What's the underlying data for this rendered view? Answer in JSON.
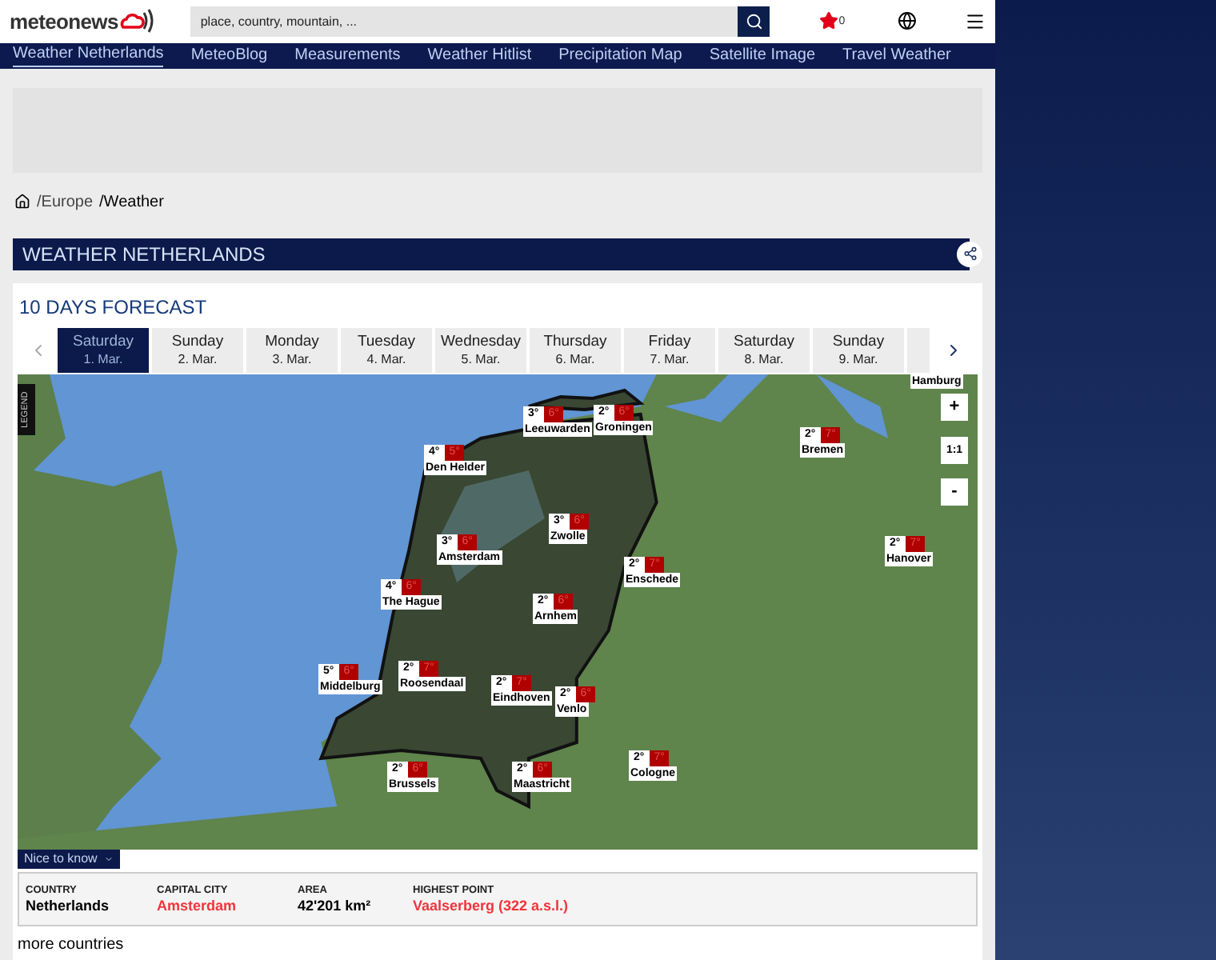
{
  "header": {
    "logo": "meteonews",
    "search": {
      "placeholder": "place, country, mountain, ..."
    },
    "favorites_count": "0"
  },
  "nav": [
    {
      "label": "Weather Netherlands",
      "selected": true
    },
    {
      "label": "MeteoBlog",
      "selected": false
    },
    {
      "label": "Measurements",
      "selected": false
    },
    {
      "label": "Weather Hitlist",
      "selected": false
    },
    {
      "label": "Precipitation Map",
      "selected": false
    },
    {
      "label": "Satellite Image",
      "selected": false
    },
    {
      "label": "Travel Weather",
      "selected": false
    }
  ],
  "breadcrumb": [
    "/Europe",
    "/Weather"
  ],
  "page_title": "WEATHER NETHERLANDS",
  "forecast": {
    "title": "10 DAYS FORECAST",
    "days": [
      {
        "day": "Saturday",
        "date": "1. Mar.",
        "selected": true
      },
      {
        "day": "Sunday",
        "date": "2. Mar.",
        "selected": false
      },
      {
        "day": "Monday",
        "date": "3. Mar.",
        "selected": false
      },
      {
        "day": "Tuesday",
        "date": "4. Mar.",
        "selected": false
      },
      {
        "day": "Wednesday",
        "date": "5. Mar.",
        "selected": false
      },
      {
        "day": "Thursday",
        "date": "6. Mar.",
        "selected": false
      },
      {
        "day": "Friday",
        "date": "7. Mar.",
        "selected": false
      },
      {
        "day": "Saturday",
        "date": "8. Mar.",
        "selected": false
      },
      {
        "day": "Sunday",
        "date": "9. Mar.",
        "selected": false
      }
    ],
    "map": {
      "legend": "LEGEND",
      "zoom_in": "+",
      "reset": "1:1",
      "zoom_out": "-",
      "markers": [
        {
          "city": "Hamburg"
        },
        {
          "city": "Leeuwarden",
          "min": "3°",
          "max": "6°"
        },
        {
          "city": "Groningen",
          "min": "2°",
          "max": "6°"
        },
        {
          "city": "Den Helder",
          "min": "4°",
          "max": "5°"
        },
        {
          "city": "Bremen",
          "min": "2°",
          "max": "7°"
        },
        {
          "city": "Zwolle",
          "min": "3°",
          "max": "6°"
        },
        {
          "city": "Amsterdam",
          "min": "3°",
          "max": "6°"
        },
        {
          "city": "Hanover",
          "min": "2°",
          "max": "7°"
        },
        {
          "city": "Enschede",
          "min": "2°",
          "max": "7°"
        },
        {
          "city": "The Hague",
          "min": "4°",
          "max": "6°"
        },
        {
          "city": "Arnhem",
          "min": "2°",
          "max": "6°"
        },
        {
          "city": "Middelburg",
          "min": "5°",
          "max": "6°"
        },
        {
          "city": "Roosendaal",
          "min": "2°",
          "max": "7°"
        },
        {
          "city": "Eindhoven",
          "min": "2°",
          "max": "7°"
        },
        {
          "city": "Venlo",
          "min": "2°",
          "max": "6°"
        },
        {
          "city": "Cologne",
          "min": "2°",
          "max": "7°"
        },
        {
          "city": "Brussels",
          "min": "2°",
          "max": "6°"
        },
        {
          "city": "Maastricht",
          "min": "2°",
          "max": "6°"
        }
      ]
    }
  },
  "nice_to_know": {
    "tab": "Nice to know",
    "facts": [
      {
        "label": "COUNTRY",
        "value": "Netherlands",
        "kind": "text"
      },
      {
        "label": "CAPITAL CITY",
        "value": "Amsterdam",
        "kind": "link"
      },
      {
        "label": "AREA",
        "value": "42'201 km²",
        "kind": "text"
      },
      {
        "label": "HIGHEST POINT",
        "value": "Vaalserberg (322 a.s.l.)",
        "kind": "link"
      }
    ]
  },
  "more_link": "more countries"
}
